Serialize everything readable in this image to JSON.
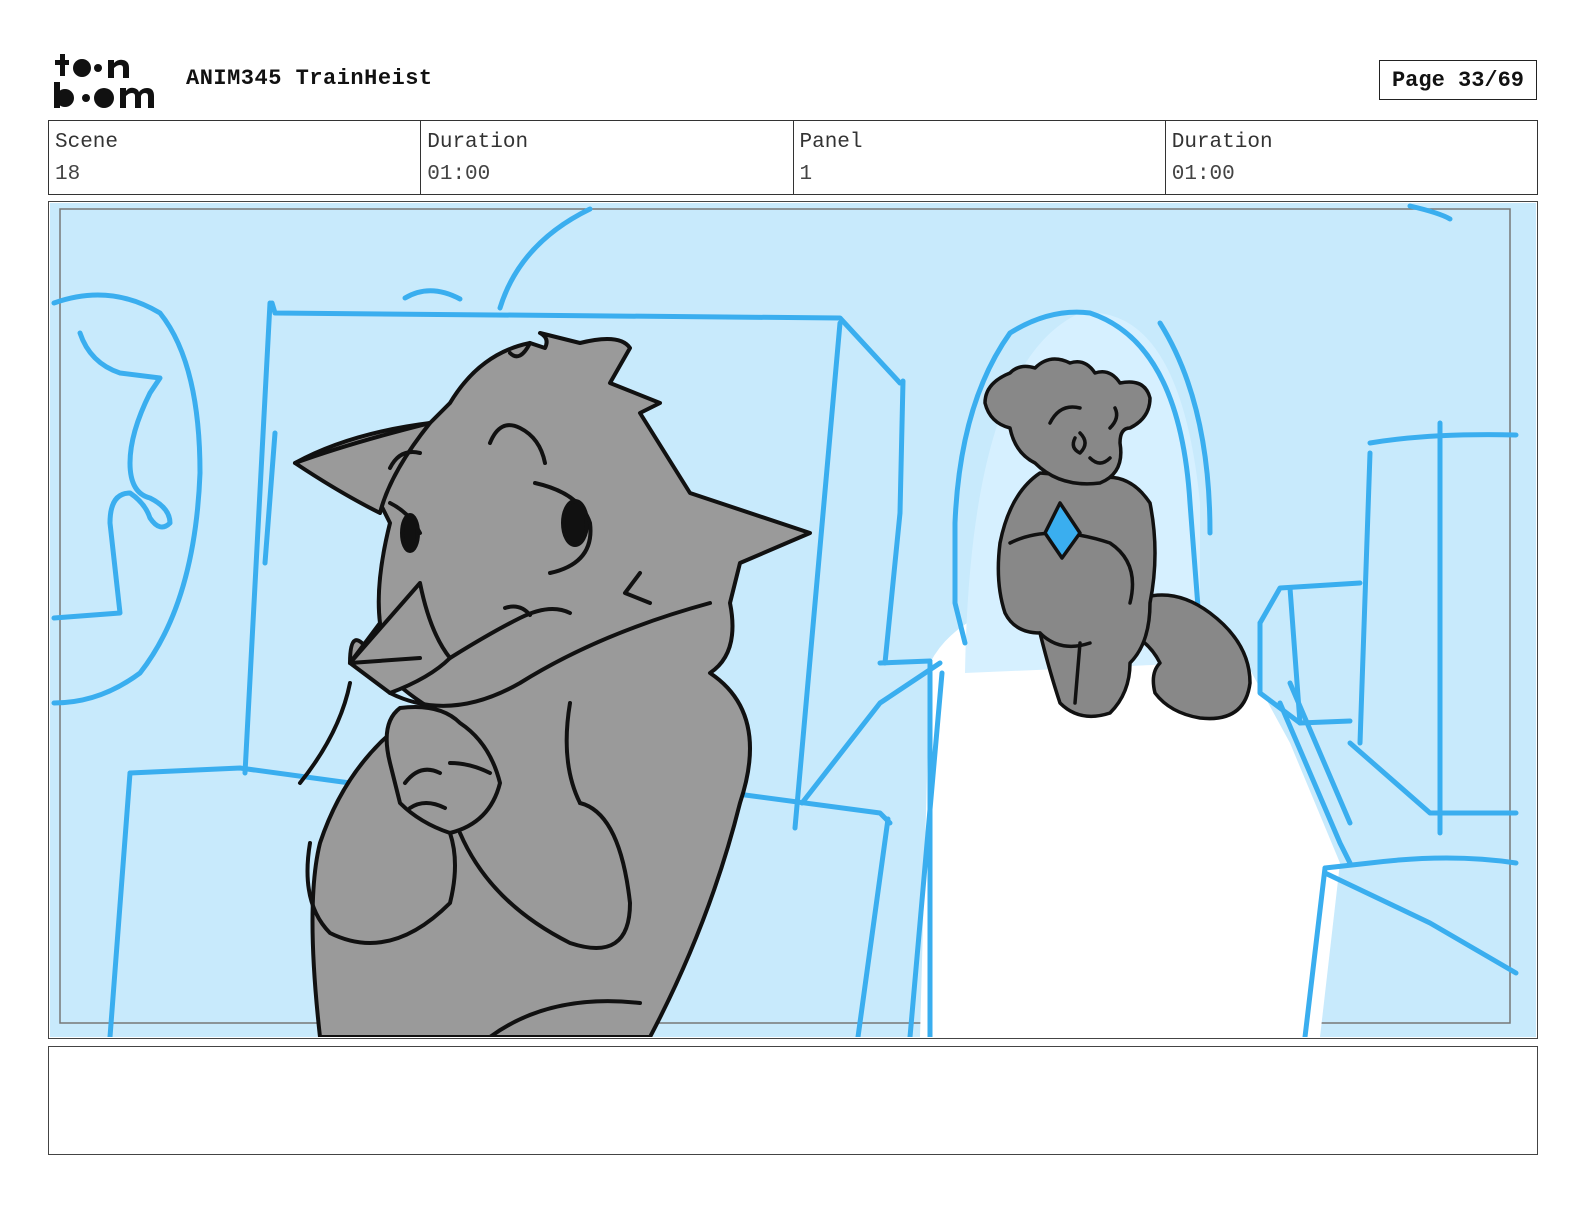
{
  "header": {
    "logo_text": "toon boom",
    "project_title": "ANIM345 TrainHeist",
    "page_label": "Page 33/69"
  },
  "info": {
    "scene_label": "Scene",
    "scene_value": "18",
    "scene_duration_label": "Duration",
    "scene_duration_value": "01:00",
    "panel_label": "Panel",
    "panel_value": "1",
    "panel_duration_label": "Duration",
    "panel_duration_value": "01:00"
  },
  "panel": {
    "background_color": "#c8eafc",
    "line_color": "#3aaeef",
    "character_fill": "#9a9a9a",
    "gem_color": "#3aaeef"
  },
  "notes": {
    "text": ""
  }
}
